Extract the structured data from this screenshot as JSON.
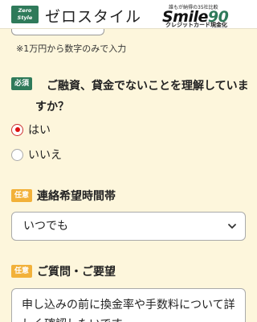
{
  "header": {
    "logo_badge_line1": "Zero",
    "logo_badge_line2": "Style",
    "logo_text": "ゼロスタイル",
    "partner_tagline": "誰もが納得の35社比較",
    "partner_name": "Smile",
    "partner_number": "90",
    "partner_subtitle": "クレジットカード現金化"
  },
  "amount": {
    "hint": "※1万円から数字のみで入力"
  },
  "question1": {
    "tag": "必須",
    "text_line1": "ご融資、貸金でないことを理解していま",
    "text_line2": "すか？",
    "options": [
      {
        "label": "はい",
        "checked": true
      },
      {
        "label": "いいえ",
        "checked": false
      }
    ]
  },
  "contact_time": {
    "tag": "任意",
    "label": "連絡希望時間帯",
    "selected": "いつでも"
  },
  "inquiry": {
    "tag": "任意",
    "label": "ご質問・ご要望",
    "value": "申し込みの前に換金率や手数料について詳しく確認したいです。"
  },
  "colors": {
    "background": "#fdf6dc",
    "required_tag": "#2f7a5a",
    "optional_tag": "#f2b13a",
    "radio_checked": "#d11111"
  }
}
